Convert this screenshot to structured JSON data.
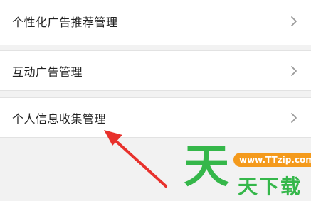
{
  "settings": {
    "items": [
      {
        "label": "个性化广告推荐管理"
      },
      {
        "label": "互动广告管理"
      },
      {
        "label": "个人信息收集管理"
      }
    ]
  },
  "annotation": {
    "color": "#e8312c"
  },
  "watermark": {
    "logo_char": "天",
    "url": "www.TTzip.com",
    "name": "天下载",
    "colors": {
      "green": "#35b74a",
      "orange": "#f49a1c"
    }
  }
}
